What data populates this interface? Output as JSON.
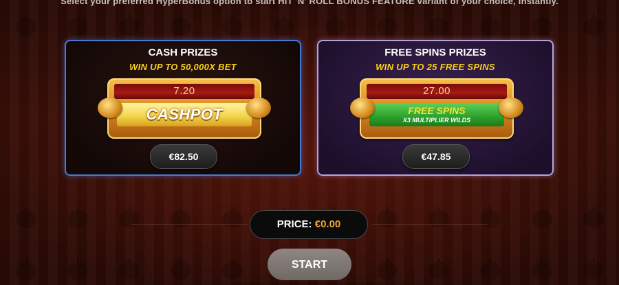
{
  "intro_text": "Select your preferred HyperBonus option to start HIT 'N' ROLL BONUS FEATURE variant of your choice, instantly.",
  "options": [
    {
      "title": "CASH PRIZES",
      "subtitle": "WIN UP TO 50,000X BET",
      "multiplier": "7.20",
      "main_label": "CASHPOT",
      "price": "€82.50"
    },
    {
      "title": "FREE SPINS PRIZES",
      "subtitle": "WIN UP TO 25 FREE SPINS",
      "multiplier": "27.00",
      "main_label": "FREE SPINS",
      "main_sublabel": "X3 MULTIPLIER WILDS",
      "price": "€47.85"
    }
  ],
  "total": {
    "label": "PRICE:",
    "amount": "€0.00"
  },
  "start_label": "START",
  "colors": {
    "accent_gold": "#f7d21c",
    "price_orange": "#f0a532",
    "cash_border": "#4a7ad0",
    "fs_border": "#b7a2d8"
  }
}
